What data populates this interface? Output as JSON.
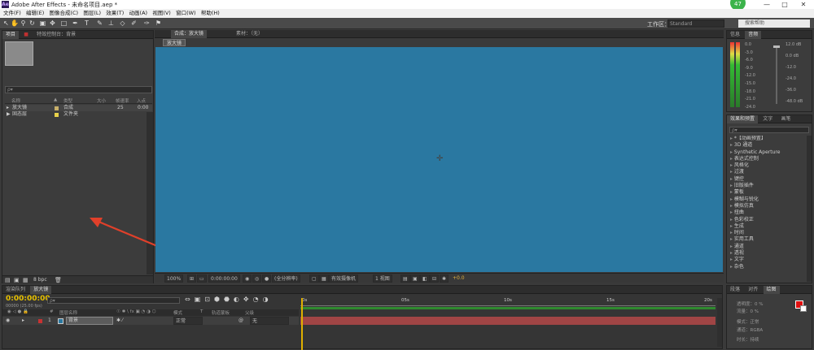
{
  "window": {
    "app_title": "Adobe After Effects - 未命名项目.aep *",
    "icon_text": "Ae"
  },
  "win_controls": {
    "min": "—",
    "max": "□",
    "close": "✕"
  },
  "menu": [
    "文件(F)",
    "编辑(E)",
    "图像合成(C)",
    "图层(L)",
    "效果(T)",
    "动画(A)",
    "视图(V)",
    "窗口(W)",
    "帮助(H)"
  ],
  "toolbar": {
    "workspace_label": "工作区：",
    "workspace_value": "Standard",
    "search_help": "搜索帮助",
    "badge": "47"
  },
  "project": {
    "tabs": [
      "项目",
      "特效控制台：背景"
    ],
    "search_placeholder": "ρ▾",
    "columns": [
      "名称",
      "▲",
      "类型",
      "大小",
      "帧速率",
      "入点"
    ],
    "items": [
      {
        "name": "放大镜",
        "type": "合成",
        "size": "",
        "fps": "25",
        "in": "0:00",
        "color": "#c8b06a",
        "icon": "▸"
      },
      {
        "name": "固态层",
        "type": "文件夹",
        "size": "",
        "fps": "",
        "in": "",
        "color": "#e8d24a",
        "icon": "▶"
      }
    ],
    "bpc": "8 bpc"
  },
  "viewer": {
    "tab_comp": "合成：放大镜",
    "tab_footage": "素材：（无）",
    "comp_chip": "放大镜",
    "zoom": "100%",
    "time": "0:00:00:00",
    "resolution": "(全分辨率)",
    "camera": "有效摄像机",
    "views": "1 视图",
    "exposure": "+0.0"
  },
  "audio": {
    "tabs": [
      "信息",
      "音频"
    ],
    "left_scale": [
      "0.0",
      "-3.0",
      "-6.0",
      "-9.0",
      "-12.0",
      "-15.0",
      "-18.0",
      "-21.0",
      "-24.0"
    ],
    "right_scale": [
      "12.0 dB",
      "0.0 dB",
      "-12.0",
      "-24.0",
      "-36.0",
      "-48.0 dB"
    ]
  },
  "effects": {
    "tabs": [
      "效果和预置",
      "文字",
      "画笔"
    ],
    "search_placeholder": "ρ▾",
    "items": [
      "*【动画预置】",
      "3D 通道",
      "Synthetic Aperture",
      "表达式控制",
      "风格化",
      "过渡",
      "键控",
      "旧版插件",
      "蒙板",
      "模糊与锐化",
      "模拟仿真",
      "扭曲",
      "色彩校正",
      "生成",
      "时间",
      "实用工具",
      "通道",
      "透视",
      "文字",
      "杂色"
    ]
  },
  "timeline": {
    "tabs": [
      "渲染队列",
      "放大镜"
    ],
    "timecode": "0:00:00:00",
    "fps_note": "00000 (25.00 fps)",
    "columns": [
      "#",
      "图层名称",
      "模式",
      "T",
      "轨道蒙板",
      "父级"
    ],
    "layer": {
      "num": "1",
      "name": "背景",
      "mode": "正常",
      "parent": "无",
      "color": "#c83232"
    },
    "ticks": [
      "0s",
      "05s",
      "10s",
      "15s",
      "20s"
    ]
  },
  "paint": {
    "tabs": [
      "段落",
      "对齐",
      "绘图"
    ],
    "opacity": "透明度：0 %",
    "flow": "流量：0 %",
    "mode_label": "模式：正常",
    "channel_label": "通道：RGBA",
    "duration_label": "时长：持续"
  },
  "colors": {
    "viewer_bg": "#2a78a1",
    "fg_color": "#e01010",
    "arrow": "#e0402a"
  }
}
